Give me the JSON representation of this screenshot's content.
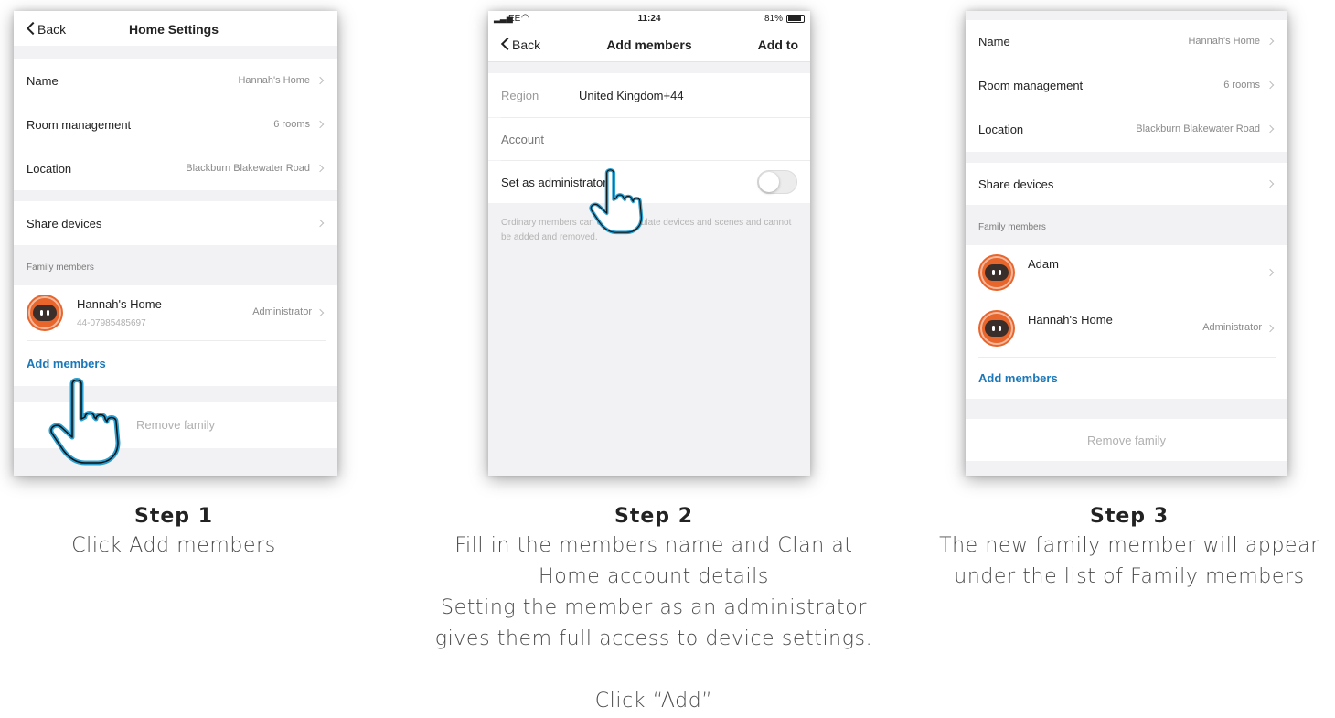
{
  "step1": {
    "header": {
      "back_label": "Back",
      "title": "Home Settings"
    },
    "settings": [
      {
        "label": "Name",
        "value": "Hannah's Home"
      },
      {
        "label": "Room management",
        "value": "6 rooms"
      },
      {
        "label": "Location",
        "value": "Blackburn Blakewater Road"
      }
    ],
    "share_devices_label": "Share devices",
    "family_section_title": "Family members",
    "member": {
      "name": "Hannah's Home",
      "phone": "44-07985485697",
      "role": "Administrator"
    },
    "add_members_label": "Add members",
    "remove_family_label": "Remove family"
  },
  "step2": {
    "status": {
      "carrier": "EE",
      "time": "11:24",
      "battery": "81%"
    },
    "header": {
      "back_label": "Back",
      "title": "Add members",
      "action_label": "Add to"
    },
    "region_label": "Region",
    "region_value": "United Kingdom+44",
    "account_placeholder": "Account",
    "admin_label": "Set as administrator",
    "admin_enabled": false,
    "note": "Ordinary members can only manipulate devices and scenes and cannot be added and removed."
  },
  "step3": {
    "settings": [
      {
        "label": "Name",
        "value": "Hannah's Home"
      },
      {
        "label": "Room management",
        "value": "6 rooms"
      },
      {
        "label": "Location",
        "value": "Blackburn Blakewater Road"
      }
    ],
    "share_devices_label": "Share devices",
    "family_section_title": "Family members",
    "members": [
      {
        "name": "Adam",
        "role": ""
      },
      {
        "name": "Hannah's Home",
        "role": "Administrator"
      }
    ],
    "add_members_label": "Add members",
    "remove_family_label": "Remove family"
  },
  "captions": [
    {
      "step": "Step 1",
      "text": "Click Add members"
    },
    {
      "step": "Step 2",
      "text": "Fill in the members name and Clan at\nHome account details\nSetting the  member as an administrator\ngives them full access to device settings.\n\nClick “Add”"
    },
    {
      "step": "Step 3",
      "text": "The new family member will appear\nunder the list of Family members"
    }
  ],
  "colors": {
    "accent": "#1a77b8",
    "hand_outline": "#2a9fd0",
    "avatar": "#e8652b"
  }
}
